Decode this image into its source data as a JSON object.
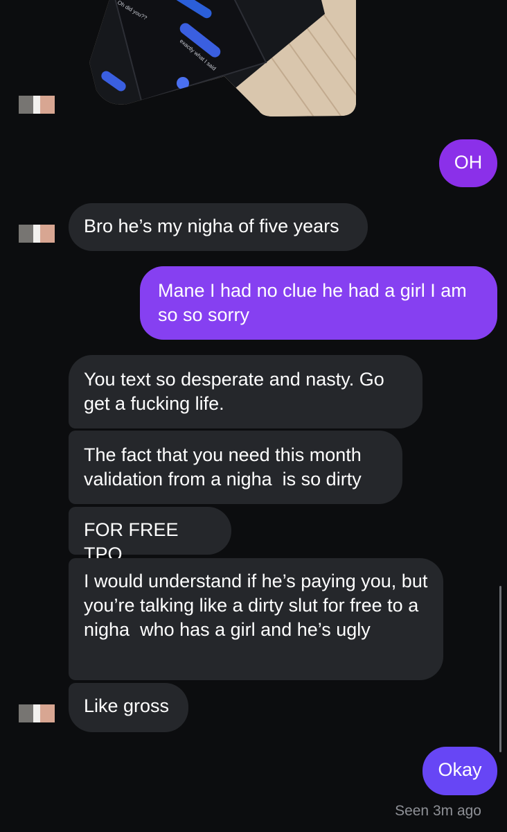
{
  "conversation": {
    "messages": [
      {
        "from": "me",
        "text": "OH"
      },
      {
        "from": "them",
        "text": "Bro he’s my nigha of five years"
      },
      {
        "from": "me",
        "text": "Mane I had no clue he had a girl I am so so sorry"
      },
      {
        "from": "them",
        "text": "You text so desperate and nasty. Go get a fucking life."
      },
      {
        "from": "them",
        "text": "The fact that you need this month validation from a nigha  is so dirty"
      },
      {
        "from": "them",
        "text": "FOR FREE TPO"
      },
      {
        "from": "them",
        "text": "I would understand if he’s paying you, but you’re talking like a dirty slut for free to a nigha  who has a girl and he’s ugly"
      },
      {
        "from": "them",
        "text": "Like gross"
      },
      {
        "from": "me",
        "text": "Okay"
      }
    ],
    "seen_status": "Seen 3m ago",
    "colors": {
      "background": "#0c0d0f",
      "incoming_bubble": "#25272b",
      "outgoing_purple": "#8a35ee",
      "outgoing_violet": "#6645f5"
    }
  },
  "shared_photo": {
    "icons": [
      "photo-of-phone-screenshot"
    ],
    "visible_text": [
      "Oh did you??",
      "exactly what I said"
    ]
  }
}
